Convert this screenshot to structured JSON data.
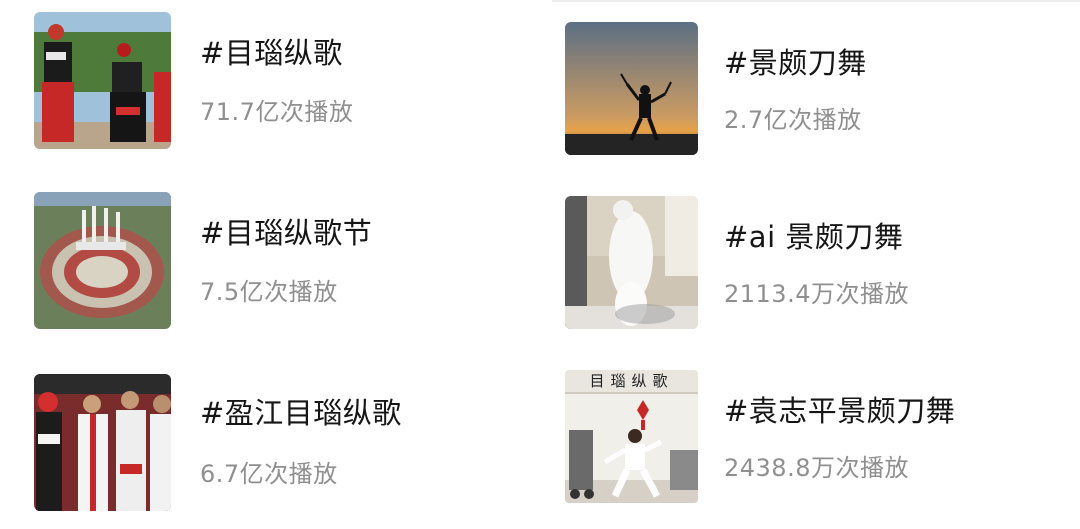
{
  "topics": [
    {
      "title": "#目瑙纵歌",
      "plays": "71.7亿次播放",
      "thumbnail": "dancers-in-traditional-costume"
    },
    {
      "title": "#景颇刀舞",
      "plays": "2.7亿次播放",
      "thumbnail": "sword-dancer-silhouette-sunset"
    },
    {
      "title": "#目瑙纵歌节",
      "plays": "7.5亿次播放",
      "thumbnail": "festival-square-aerial-crowd"
    },
    {
      "title": "#ai 景颇刀舞",
      "plays": "2113.4万次播放",
      "thumbnail": "white-dog-in-room"
    },
    {
      "title": "#盈江目瑙纵歌",
      "plays": "6.7亿次播放",
      "thumbnail": "crowd-in-ethnic-costume"
    },
    {
      "title": "#袁志平景颇刀舞",
      "plays": "2438.8万次播放",
      "thumbnail": "woman-dancing-indoors",
      "thumbnail_text": "目瑙纵歌"
    }
  ]
}
